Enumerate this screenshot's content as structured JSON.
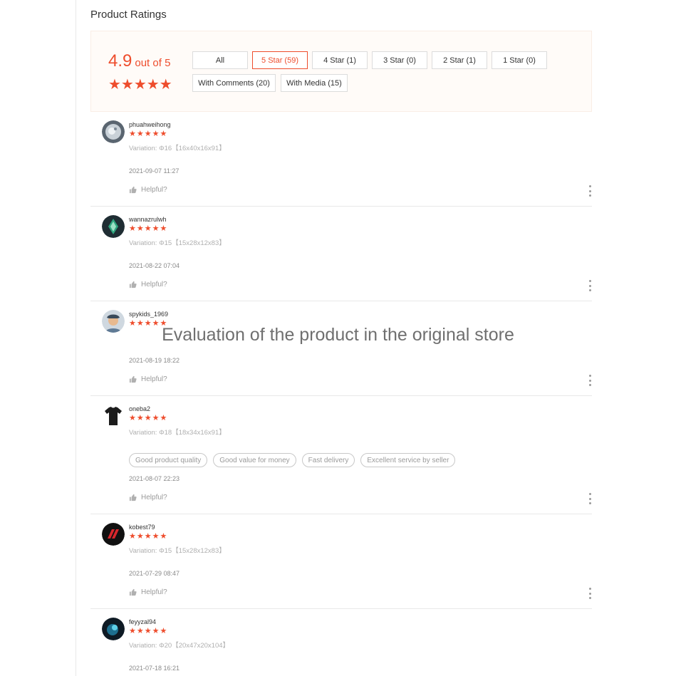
{
  "section_title": "Product Ratings",
  "overview": {
    "score": "4.9",
    "out_of": "out of 5",
    "stars": "★★★★★",
    "rating_value": 4.9,
    "accent_color": "#ee4d2d"
  },
  "filters": [
    {
      "label": "All",
      "active": false
    },
    {
      "label": "5 Star (59)",
      "active": true
    },
    {
      "label": "4 Star (1)",
      "active": false
    },
    {
      "label": "3 Star (0)",
      "active": false
    },
    {
      "label": "2 Star (1)",
      "active": false
    },
    {
      "label": "1 Star (0)",
      "active": false
    },
    {
      "label": "With Comments (20)",
      "active": false
    },
    {
      "label": "With Media (15)",
      "active": false
    }
  ],
  "reviews": [
    {
      "username": "phuahweihong",
      "stars": "★★★★★",
      "rating": 5,
      "variation": "Variation: Φ16【16x40x16x91】",
      "date": "2021-09-07 11:27",
      "helpful": "Helpful?",
      "tags": []
    },
    {
      "username": "wannazrulwh",
      "stars": "★★★★★",
      "rating": 5,
      "variation": "Variation: Φ15【15x28x12x83】",
      "date": "2021-08-22 07:04",
      "helpful": "Helpful?",
      "tags": []
    },
    {
      "username": "spykids_1969",
      "stars": "★★★★★",
      "rating": 5,
      "variation": "",
      "date": "2021-08-19 18:22",
      "helpful": "Helpful?",
      "tags": []
    },
    {
      "username": "oneba2",
      "stars": "★★★★★",
      "rating": 5,
      "variation": "Variation: Φ18【18x34x16x91】",
      "date": "2021-08-07 22:23",
      "helpful": "Helpful?",
      "tags": [
        "Good product quality",
        "Good value for money",
        "Fast delivery",
        "Excellent service by seller"
      ]
    },
    {
      "username": "kobest79",
      "stars": "★★★★★",
      "rating": 5,
      "variation": "Variation: Φ15【15x28x12x83】",
      "date": "2021-07-29 08:47",
      "helpful": "Helpful?",
      "tags": []
    },
    {
      "username": "feyyzal94",
      "stars": "★★★★★",
      "rating": 5,
      "variation": "Variation: Φ20【20x47x20x104】",
      "date": "2021-07-18 16:21",
      "helpful": "Helpful?",
      "tags": []
    }
  ],
  "watermark": "Evaluation of the product in the original store",
  "icons": {
    "helpful": "thumbs-up-icon",
    "more": "more-vertical-icon"
  }
}
